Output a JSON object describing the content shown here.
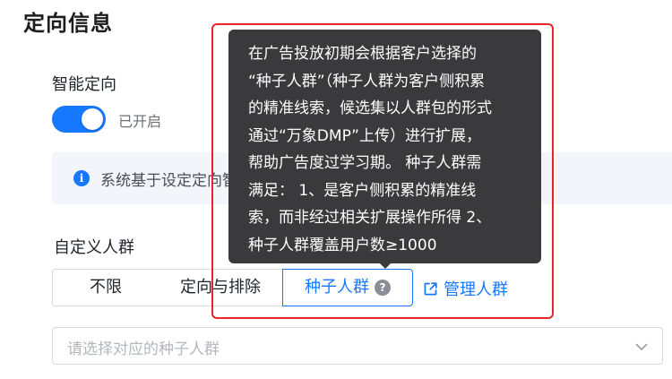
{
  "page": {
    "title": "定向信息"
  },
  "smart_targeting": {
    "label": "智能定向",
    "toggle_on": true,
    "status_text": "已开启",
    "info_text": "系统基于设定定向智能探索更多优质人群，提升广告跑量能力。"
  },
  "custom_audience": {
    "label": "自定义人群",
    "tabs": [
      "不限",
      "定向与排除",
      "种子人群"
    ],
    "selected_tab": "种子人群",
    "help_icon_glyph": "?",
    "manage_link": "管理人群",
    "select_placeholder": "请选择对应的种子人群"
  },
  "tooltip": {
    "lines": [
      "在广告投放初期会根据客户选择的",
      "“种子人群”（种子人群为客户侧积累",
      "的精准线索，候选集以人群包的形式",
      "通过“万象DMP”上传）进行扩展，",
      "帮助广告度过学习期。 种子人群需",
      "满足：  1、是客户侧积累的精准线",
      "索，而非经过相关扩展操作所得 2、",
      "种子人群覆盖用户数≥1000"
    ]
  },
  "colors": {
    "accent": "#1677ff",
    "highlight_frame": "#e8262a",
    "tooltip_bg": "#3a3a3c"
  },
  "icons": [
    "info-icon",
    "help-icon",
    "external-link-icon",
    "chevron-down-icon"
  ]
}
